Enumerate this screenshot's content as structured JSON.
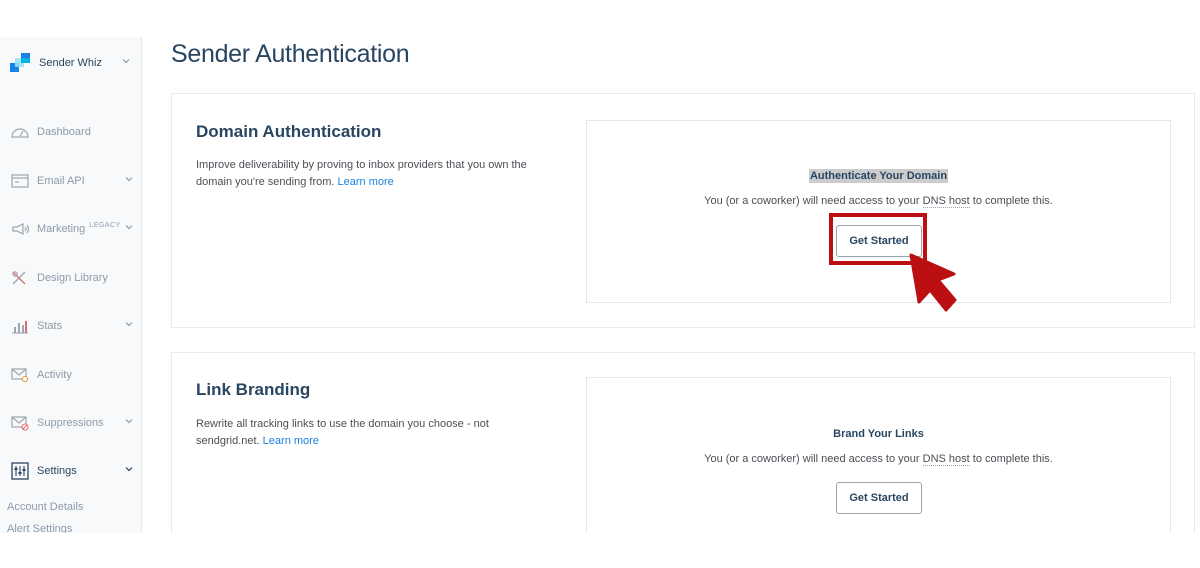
{
  "sidebar": {
    "brand": "Sender Whiz",
    "items": [
      {
        "label": "Dashboard",
        "icon": "dashboard-icon"
      },
      {
        "label": "Email API",
        "icon": "email-api-icon"
      },
      {
        "label": "Marketing",
        "badge": "LEGACY",
        "icon": "megaphone-icon"
      },
      {
        "label": "Design Library",
        "icon": "design-library-icon"
      },
      {
        "label": "Stats",
        "icon": "stats-icon"
      },
      {
        "label": "Activity",
        "icon": "activity-icon"
      },
      {
        "label": "Suppressions",
        "icon": "suppressions-icon"
      },
      {
        "label": "Settings",
        "icon": "settings-sliders-icon"
      }
    ],
    "settings_sub": [
      "Account Details",
      "Alert Settings"
    ]
  },
  "page": {
    "title": "Sender Authentication"
  },
  "domain_auth": {
    "title": "Domain Authentication",
    "description": "Improve deliverability by proving to inbox providers that you own the domain you're sending from.",
    "learn_more": "Learn more",
    "panel_title": "Authenticate Your Domain",
    "panel_desc_before": "You (or a coworker) will need access to your ",
    "panel_desc_dns": "DNS host",
    "panel_desc_after": " to complete this.",
    "button": "Get Started"
  },
  "link_branding": {
    "title": "Link Branding",
    "description": "Rewrite all tracking links to use the domain you choose - not sendgrid.net.",
    "learn_more": "Learn more",
    "panel_title": "Brand Your Links",
    "panel_desc_before": "You (or a coworker) will need access to your ",
    "panel_desc_dns": "DNS host",
    "panel_desc_after": " to complete this.",
    "button": "Get Started"
  },
  "colors": {
    "brand_blue": "#1a82e2",
    "heading": "#294661",
    "annotation_red": "#bb0f12"
  }
}
